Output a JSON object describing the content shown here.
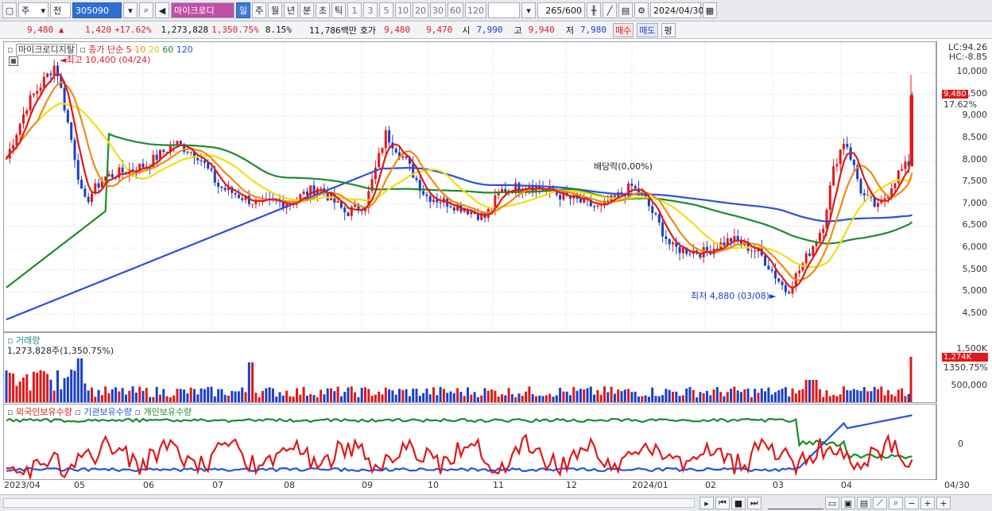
{
  "toolbar": {
    "market": "주",
    "type": "전",
    "code": "305090",
    "name": "마이크로디",
    "periods": [
      "일",
      "주",
      "월",
      "년",
      "분",
      "초",
      "틱"
    ],
    "selected_period": "일",
    "intervals": [
      "1",
      "3",
      "5",
      "10",
      "20",
      "30",
      "60",
      "120"
    ],
    "count": "265",
    "count_total": "/600",
    "date": "2024/04/30"
  },
  "pricebar": {
    "price": "9,480",
    "change": "1,420",
    "change_pct": "+17.62%",
    "volume": "1,273,828",
    "volume_ratio": "1,350.75%",
    "turnover": "8.15%",
    "amount": "11,786백만",
    "quote_label": "호가",
    "ask": "9,480",
    "bid": "9,470",
    "open_label": "시",
    "open": "7,990",
    "high_label": "고",
    "high": "9,940",
    "low_label": "저",
    "low": "7,980",
    "buy": "매수",
    "sell": "매도",
    "eval": "평"
  },
  "price_pane": {
    "legend_name": "마이크로디지탈",
    "legend_ma": "종가 단순",
    "ma_periods": [
      "5",
      "10",
      "20",
      "60",
      "120"
    ],
    "ma_colors": [
      "#e01818",
      "#f08c10",
      "#f0e010",
      "#1c8c2c",
      "#2850e0"
    ],
    "high_label": "최고 10,400 (04/24)",
    "low_label": "최저 4,880 (03/08)",
    "dividend_label": "배당락(0,00%)",
    "lc": "LC:94.26",
    "hc": "HC:-8.85",
    "last_price_tag": "9,480",
    "last_pct_tag": "17.62%",
    "y_ticks": [
      "10,000",
      "9,500",
      "9,000",
      "8,500",
      "8,000",
      "7,500",
      "7,000",
      "6,500",
      "6,000",
      "5,500",
      "5,000",
      "4,500"
    ]
  },
  "volume_pane": {
    "title": "거래량",
    "value": "1,273,828주(1,350.75%)",
    "y_ticks": [
      "1,500K",
      "500,000"
    ],
    "last_tag": "1,274K",
    "last_pct": "1350.75%"
  },
  "holding_pane": {
    "series": [
      "외국인보유수량",
      "기관보유수량",
      "개인보유수량"
    ],
    "colors": [
      "#e01818",
      "#2850e0",
      "#1c8c2c"
    ],
    "y_tick": "0"
  },
  "x_labels": [
    "2023/04",
    "05",
    "06",
    "07",
    "08",
    "09",
    "10",
    "11",
    "12",
    "2024/01",
    "02",
    "03",
    "04"
  ],
  "x_last": "04/30"
}
